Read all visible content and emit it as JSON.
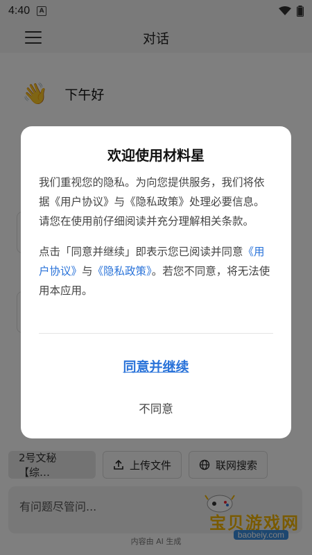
{
  "status_bar": {
    "time": "4:40",
    "badge": "A"
  },
  "header": {
    "title": "对话"
  },
  "greeting": {
    "emoji": "👋",
    "text": "下午好"
  },
  "chips": {
    "assistant": "2号文秘【综…",
    "upload": "上传文件",
    "web_search": "联网搜索"
  },
  "input": {
    "placeholder": "有问题尽管问..."
  },
  "footnote": "内容由 AI 生成",
  "watermark": {
    "text": "宝贝游戏网",
    "url": "baobeiy.com"
  },
  "modal": {
    "title": "欢迎使用材料星",
    "para1": "我们重视您的隐私。为向您提供服务，我们将依据《用户协议》与《隐私政策》处理必要信息。请您在使用前仔细阅读并充分理解相关条款。",
    "para2_prefix": "点击「同意并继续」即表示您已阅读并同意",
    "link_user_agreement": "《用户协议》",
    "conj": "与",
    "link_privacy": "《隐私政策》",
    "para2_suffix": "。若您不同意，将无法使用本应用。",
    "agree_label": "同意并继续",
    "disagree_label": "不同意"
  },
  "colors": {
    "link": "#2a73d9",
    "overlay": "rgba(0,0,0,0.5)",
    "watermark": "#f2b400"
  }
}
